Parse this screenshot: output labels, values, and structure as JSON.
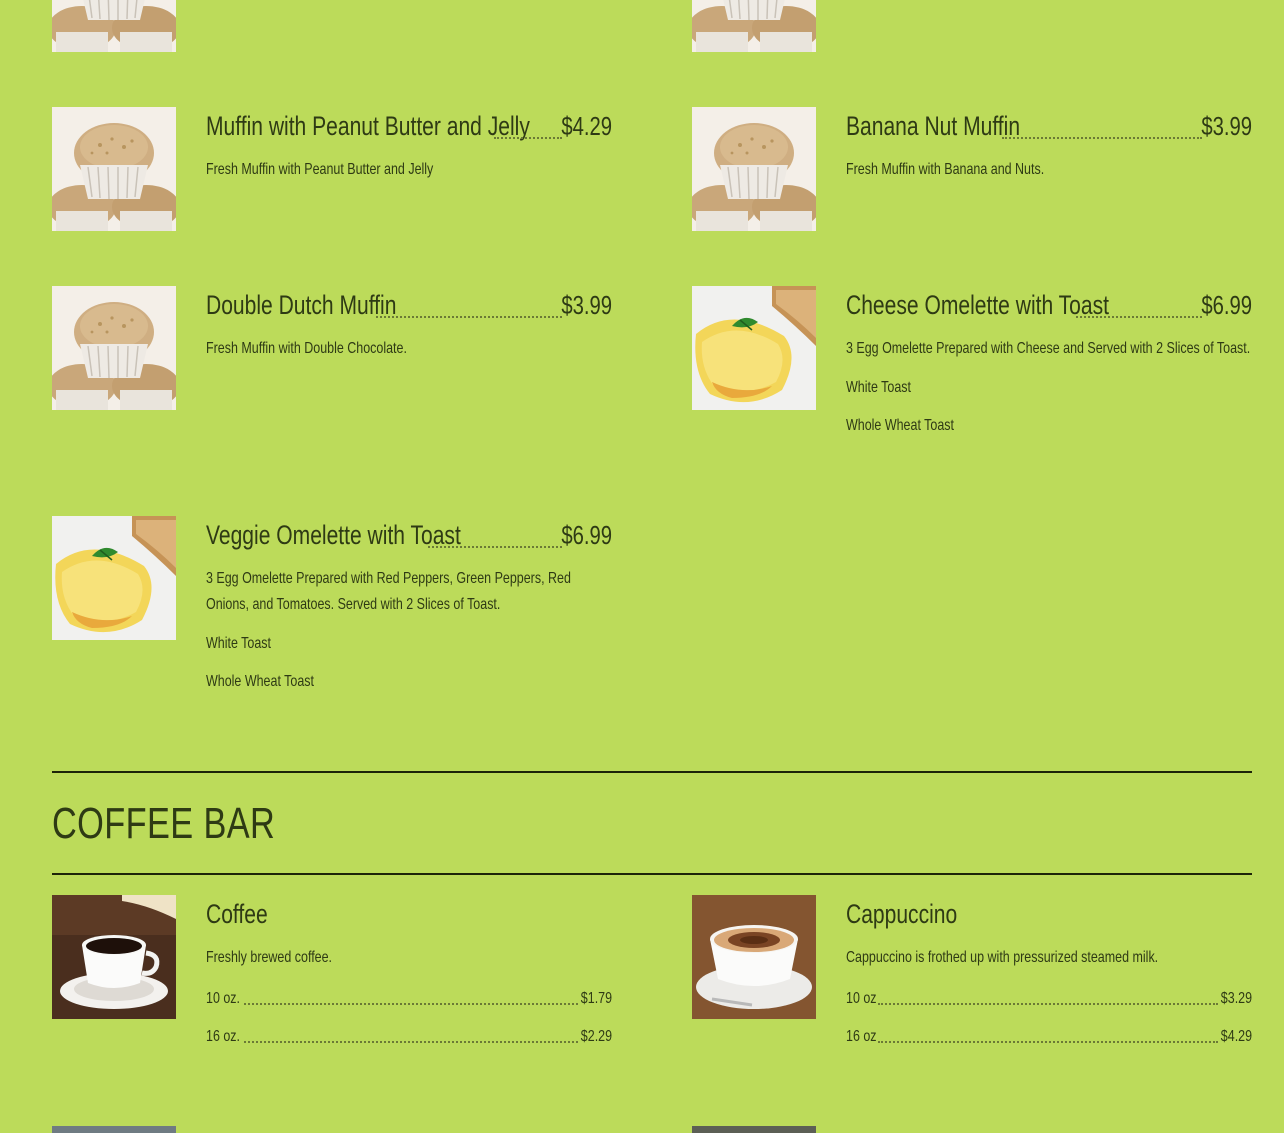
{
  "breakfast": {
    "muffin_pbj": {
      "name": "Muffin with Peanut Butter and Jelly",
      "price": "$4.29",
      "desc": "Fresh Muffin with Peanut Butter and Jelly",
      "image": "muffin-photo"
    },
    "banana_nut": {
      "name": "Banana Nut Muffin",
      "price": "$3.99",
      "desc": "Fresh Muffin with Banana and Nuts.",
      "image": "muffin-photo"
    },
    "double_dutch": {
      "name": "Double Dutch Muffin",
      "price": "$3.99",
      "desc": "Fresh Muffin with Double Chocolate.",
      "image": "muffin-photo"
    },
    "cheese_omelette": {
      "name": "Cheese Omelette with Toast",
      "price": "$6.99",
      "desc": "3 Egg Omelette Prepared with Cheese and Served with 2 Slices of Toast.",
      "options": [
        "White Toast",
        "Whole Wheat Toast"
      ],
      "image": "omelette-photo"
    },
    "veggie_omelette": {
      "name": "Veggie Omelette with Toast",
      "price": "$6.99",
      "desc": "3 Egg Omelette Prepared with Red Peppers, Green Peppers, Red Onions, and Tomatoes. Served with 2 Slices of Toast.",
      "options": [
        "White Toast",
        "Whole Wheat Toast"
      ],
      "image": "omelette-photo"
    }
  },
  "coffee_bar": {
    "title": "COFFEE BAR",
    "coffee": {
      "name": "Coffee",
      "desc": "Freshly brewed coffee.",
      "sizes": [
        {
          "size": "10 oz.",
          "price": "$1.79"
        },
        {
          "size": "16 oz.",
          "price": "$2.29"
        }
      ],
      "image": "coffee-cup-photo"
    },
    "cappuccino": {
      "name": "Cappuccino",
      "desc": "Cappuccino is frothed up with pressurized steamed milk.",
      "sizes": [
        {
          "size": "10 oz",
          "price": "$3.29"
        },
        {
          "size": "16 oz",
          "price": "$4.29"
        }
      ],
      "image": "cappuccino-photo"
    }
  },
  "colors": {
    "background": "#bcdb5a",
    "text": "#2e3a14",
    "rule": "#1c2408"
  }
}
